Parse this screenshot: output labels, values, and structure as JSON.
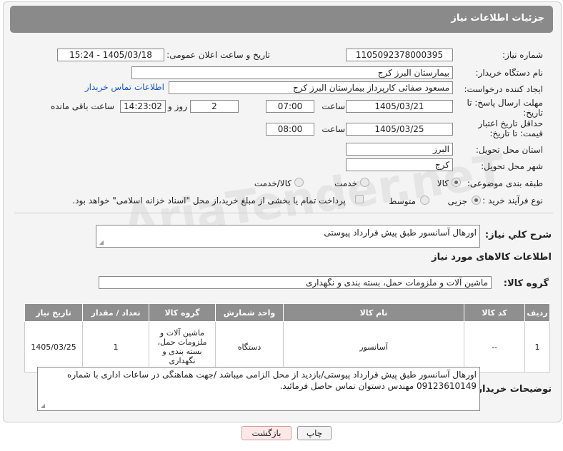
{
  "header": {
    "title": "جزئیات اطلاعات نیاز"
  },
  "form": {
    "need_number_label": "شماره نیاز:",
    "need_number": "1105092378000395",
    "announce_label": "تاریخ و ساعت اعلان عمومی:",
    "announce_value": "1405/03/18 - 15:24",
    "buyer_org_label": "نام دستگاه خریدار:",
    "buyer_org": "بیمارستان البرز کرج",
    "creator_label": "ایجاد کننده درخواست:",
    "creator": "مسعود صفائی کارپرداز بیمارستان البرز کرج",
    "contact_link": "اطلاعات تماس خریدار",
    "reply_deadline_label": "مهلت ارسال پاسخ: تا تاریخ:",
    "reply_date": "1405/03/21",
    "hour_label": "ساعت",
    "reply_time": "07:00",
    "days_value": "2",
    "days_label": "روز و",
    "remaining_time": "14:23:02",
    "remaining_label": "ساعت باقی مانده",
    "price_deadline_label": "حداقل تاریخ اعتبار قیمت: تا تاریخ:",
    "price_date": "1405/03/25",
    "price_hour_label": "ساعت",
    "price_time": "08:00",
    "province_label": "استان محل تحویل:",
    "province": "البرز",
    "city_label": "شهر محل تحویل:",
    "city": "کرج",
    "category_label": "طبقه بندی موضوعی:",
    "category_options": [
      "کالا",
      "خدمت",
      "کالا/خدمت"
    ],
    "category_selected": "کالا",
    "purchase_type_label": "نوع فرآیند خرید :",
    "purchase_options": [
      "جزیی",
      "متوسط"
    ],
    "purchase_selected": "جزیی",
    "payment_note": "پرداخت تمام یا بخشی از مبلغ خرید،از محل \"اسناد خزانه اسلامی\" خواهد بود."
  },
  "description": {
    "label": "شرح کلي نياز:",
    "value": "اورهال آسانسور طبق پیش قرارداد پیوستی"
  },
  "goods_info": {
    "title": "اطلاعات کالاهای مورد نیاز",
    "group_label": "گروه کالا:",
    "group_value": "ماشین آلات و ملزومات حمل، بسته بندی و نگهداری"
  },
  "table": {
    "headers": [
      "ردیف",
      "کد کالا",
      "نام کالا",
      "واحد شمارش",
      "گروه کالا",
      "تعداد / مقدار",
      "تاریخ نیاز"
    ],
    "rows": [
      {
        "row": "1",
        "code": "--",
        "name": "آسانسور",
        "unit": "دستگاه",
        "group": "ماشین آلات و ملزومات حمل، بسته بندی و نگهداری",
        "qty": "1",
        "date": "1405/03/25"
      }
    ]
  },
  "buyer_notes": {
    "label": "توضیحات خریدار:",
    "value": "اورهال آسانسور طبق پیش قرارداد پیوستی/بازدید از محل الزامی میباشد /جهت هماهنگی در ساعات اداری با شماره 09123610149 مهندس دستوان  تماس حاصل فرمائید."
  },
  "buttons": {
    "print": "چاپ",
    "back": "بازگشت"
  },
  "watermark": "AriaTender.neT"
}
